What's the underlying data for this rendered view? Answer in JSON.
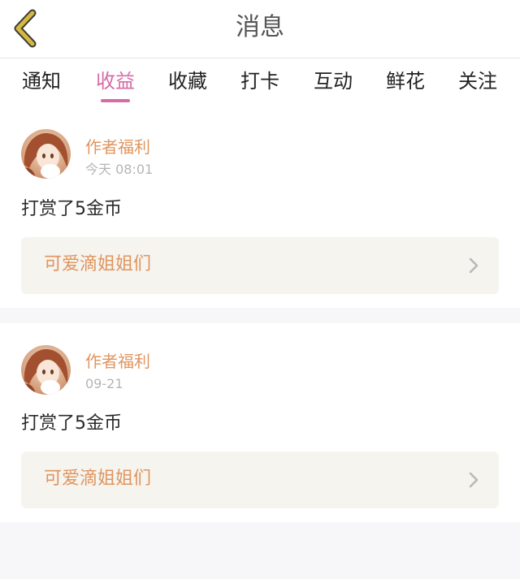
{
  "header": {
    "title": "消息",
    "back_icon": "chevron-left-icon",
    "back_color": "#d6b83c"
  },
  "tabs": [
    {
      "label": "通知",
      "active": false
    },
    {
      "label": "收益",
      "active": true
    },
    {
      "label": "收藏",
      "active": false
    },
    {
      "label": "打卡",
      "active": false
    },
    {
      "label": "互动",
      "active": false
    },
    {
      "label": "鲜花",
      "active": false
    },
    {
      "label": "关注",
      "active": false
    }
  ],
  "accent_color": "#d76ba6",
  "messages": [
    {
      "author": "作者福利",
      "time": "今天 08:01",
      "text": "打赏了5金币",
      "link_text": "可爱滴姐姐们",
      "link_icon": "chevron-right-icon"
    },
    {
      "author": "作者福利",
      "time": "09-21",
      "text": "打赏了5金币",
      "link_text": "可爱滴姐姐们",
      "link_icon": "chevron-right-icon"
    }
  ]
}
